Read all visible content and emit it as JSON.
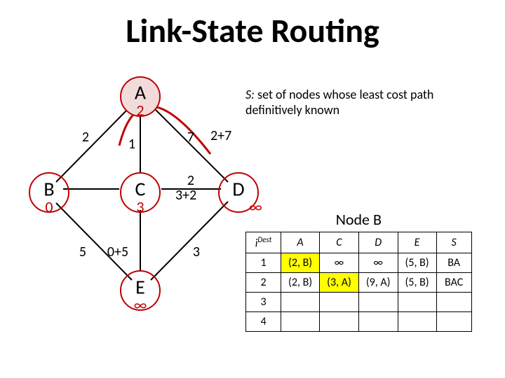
{
  "title": "Link-State Routing",
  "note": {
    "prefix": "S:",
    "text": " set of nodes whose least cost path definitively known"
  },
  "graph": {
    "nodes": {
      "A": {
        "label": "A",
        "sub": "2"
      },
      "B": {
        "label": "B",
        "sub": "0"
      },
      "C": {
        "label": "C",
        "sub": "3"
      },
      "D": {
        "label": "D",
        "sub": "∞"
      },
      "E": {
        "label": "E",
        "sub": "∞"
      }
    },
    "edges": {
      "AB": "2",
      "AC": "1",
      "AD": "7",
      "BC": "",
      "BE": "5",
      "CD": "2",
      "CE": "0+5",
      "DE": "3"
    },
    "annotations": {
      "ad_calc": "2+7",
      "cd_calc": "3+2"
    }
  },
  "table": {
    "caption": "Node B",
    "headers": {
      "iter": "i",
      "iter_sup": "Dest",
      "A": "A",
      "C": "C",
      "D": "D",
      "E": "E",
      "S": "S"
    },
    "rows": [
      {
        "i": "1",
        "A": "(2, B)",
        "C": "∞",
        "D": "∞",
        "E": "(5, B)",
        "S": "BA",
        "hl": [
          "A"
        ]
      },
      {
        "i": "2",
        "A": "(2, B)",
        "C": "(3, A)",
        "D": "(9, A)",
        "E": "(5, B)",
        "S": "BAC",
        "hl": [
          "C"
        ]
      },
      {
        "i": "3",
        "A": "",
        "C": "",
        "D": "",
        "E": "",
        "S": "",
        "hl": []
      },
      {
        "i": "4",
        "A": "",
        "C": "",
        "D": "",
        "E": "",
        "S": "",
        "hl": []
      }
    ]
  }
}
